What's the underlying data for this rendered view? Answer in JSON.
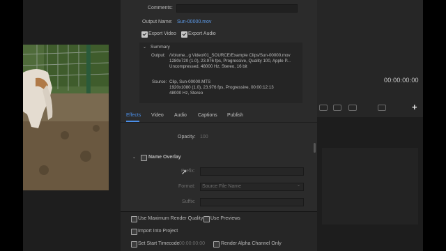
{
  "export": {
    "comments_label": "Comments:",
    "comments_value": "",
    "output_name_label": "Output Name:",
    "output_name": "Sun-00000.mov",
    "export_video_label": "Export Video",
    "export_audio_label": "Export Audio",
    "export_video_checked": true,
    "export_audio_checked": true
  },
  "summary": {
    "title": "Summary",
    "output_label": "Output:",
    "output_lines": [
      "/Volume...g Video/01_SOURCE/Example Clips/Sun-00000.mov",
      "1280x720 (1.0), 23.976 fps, Progressive, Quality 100, Apple P...",
      "Uncompressed, 48000 Hz, Stereo, 16 bit"
    ],
    "source_label": "Source:",
    "source_lines": [
      "Clip, Sun-00000.MTS",
      "1920x1080 (1.0), 23.976 fps, Progressive, 00:00:12:13",
      "48000 Hz, Stereo"
    ]
  },
  "tabs": [
    "Effects",
    "Video",
    "Audio",
    "Captions",
    "Publish"
  ],
  "active_tab": "Effects",
  "effects": {
    "opacity_label": "Opacity:",
    "opacity_value": "100",
    "name_overlay_label": "Name Overlay",
    "prefix_label": "Prefix:",
    "format_label": "Format:",
    "format_value": "Source File Name",
    "suffix_label": "Suffix:"
  },
  "bottom": {
    "max_render_quality": "Use Maximum Render Quality",
    "use_previews": "Use Previews",
    "import_into_project": "Import Into Project",
    "set_start_timecode": "Set Start Timecode",
    "start_timecode_value": "00:00:00:00",
    "render_alpha": "Render Alpha Channel Only"
  },
  "program": {
    "timecode": "00:00:00:00",
    "add_symbol": "+"
  },
  "colors": {
    "accent": "#4b8fe8",
    "dialog_bg": "#2b2b2b"
  }
}
